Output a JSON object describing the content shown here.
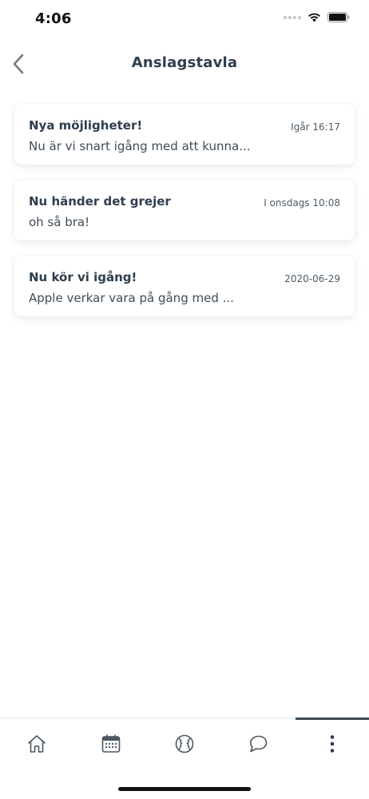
{
  "status_bar": {
    "time": "4:06"
  },
  "header": {
    "title": "Anslagstavla"
  },
  "notices": [
    {
      "title": "Nya möjligheter!",
      "date": "Igår 16:17",
      "preview": "Nu är vi snart igång med att kunna..."
    },
    {
      "title": "Nu händer det grejer",
      "date": "I onsdags 10:08",
      "preview": "oh så bra!"
    },
    {
      "title": "Nu kör vi igång!",
      "date": "2020-06-29",
      "preview": "Apple verkar vara på gång med ..."
    }
  ],
  "tab_bar": {
    "tabs": [
      {
        "icon": "home-icon"
      },
      {
        "icon": "calendar-icon"
      },
      {
        "icon": "ball-icon"
      },
      {
        "icon": "chat-icon"
      },
      {
        "icon": "more-vertical-icon",
        "active": true
      }
    ]
  },
  "colors": {
    "text": "#2f3e4e",
    "active_indicator": "#3c4a56"
  }
}
